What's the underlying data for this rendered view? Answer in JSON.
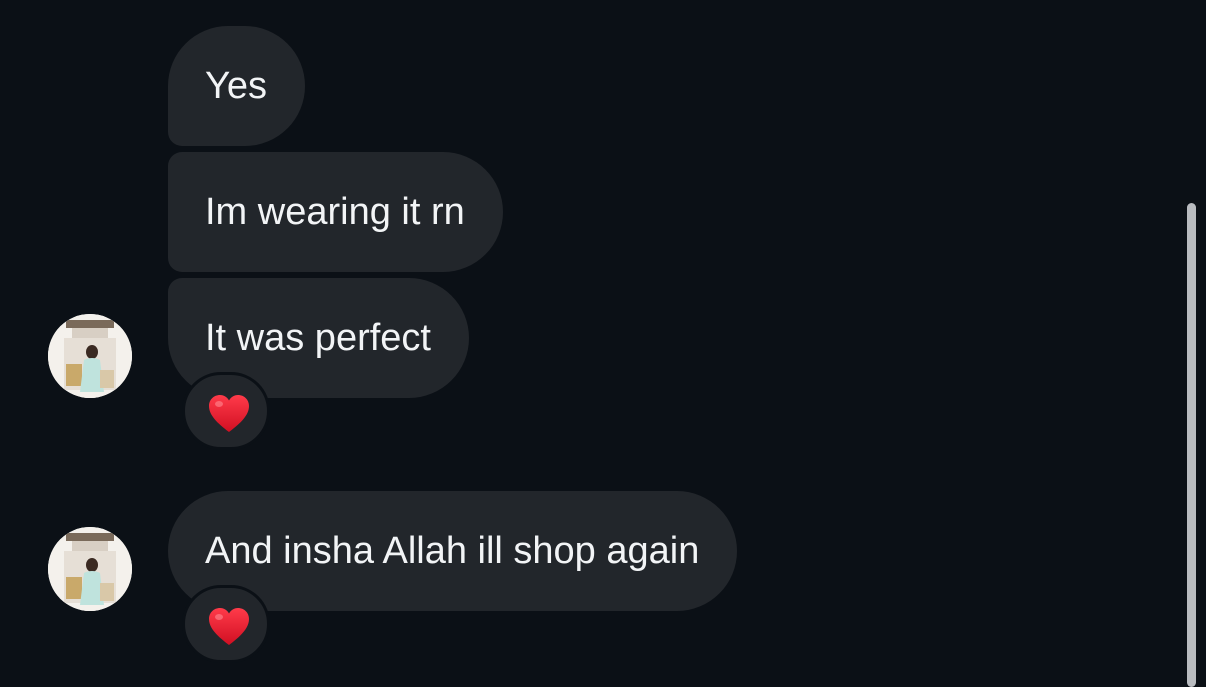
{
  "messages": [
    {
      "text": "Yes"
    },
    {
      "text": "Im wearing it rn"
    },
    {
      "text": "It was perfect",
      "reaction": "red-heart"
    },
    {
      "text": "And insha Allah ill shop again",
      "reaction": "red-heart"
    }
  ],
  "colors": {
    "background": "#0b1016",
    "bubble": "#22262b",
    "text": "#f2f4f6",
    "heart": "#e3162a",
    "scrollbar": "#b9bcc0"
  }
}
